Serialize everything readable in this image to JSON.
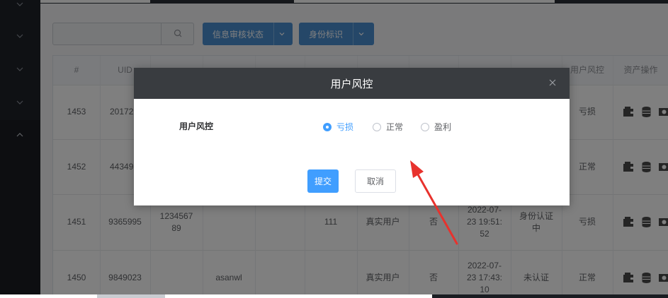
{
  "toolbar": {
    "search_placeholder": "",
    "filter_audit_label": "信息审核状态",
    "filter_identity_label": "身份标识"
  },
  "table": {
    "headers": [
      "#",
      "UID",
      "",
      "",
      "",
      "",
      "",
      "",
      "",
      "",
      "用户风控",
      "资产操作"
    ],
    "rows": [
      {
        "id": "1453",
        "uid": "20172",
        "phone": "",
        "name": "",
        "col5": "",
        "col6": "",
        "type": "",
        "flag": "",
        "time": "",
        "auth": "",
        "risk": "亏损"
      },
      {
        "id": "1452",
        "uid": "44349",
        "phone": "",
        "name": "",
        "col5": "",
        "col6": "",
        "type": "",
        "flag": "",
        "time": "",
        "auth": "",
        "risk": "正常"
      },
      {
        "id": "1451",
        "uid": "9365995",
        "phone": "123456789",
        "name": "",
        "col5": "",
        "col6": "111",
        "type": "真实用户",
        "flag": "否",
        "time": "2022-07-23 19:51:52",
        "auth": "身份认证中",
        "risk": "亏损"
      },
      {
        "id": "1450",
        "uid": "9849023",
        "phone": "",
        "name": "asanwl",
        "col5": "",
        "col6": "",
        "type": "真实用户",
        "flag": "否",
        "time": "2022-07-23 17:43:10",
        "auth": "未认证",
        "risk": "正常"
      }
    ]
  },
  "modal": {
    "title": "用户风控",
    "field_label": "用户风控",
    "options": [
      {
        "label": "亏损",
        "checked": true
      },
      {
        "label": "正常",
        "checked": false
      },
      {
        "label": "盈利",
        "checked": false
      }
    ],
    "submit_label": "提交",
    "cancel_label": "取消"
  },
  "colors": {
    "primary": "#409eff",
    "modal_header": "#393c40",
    "annotation_arrow": "#e8322d"
  }
}
